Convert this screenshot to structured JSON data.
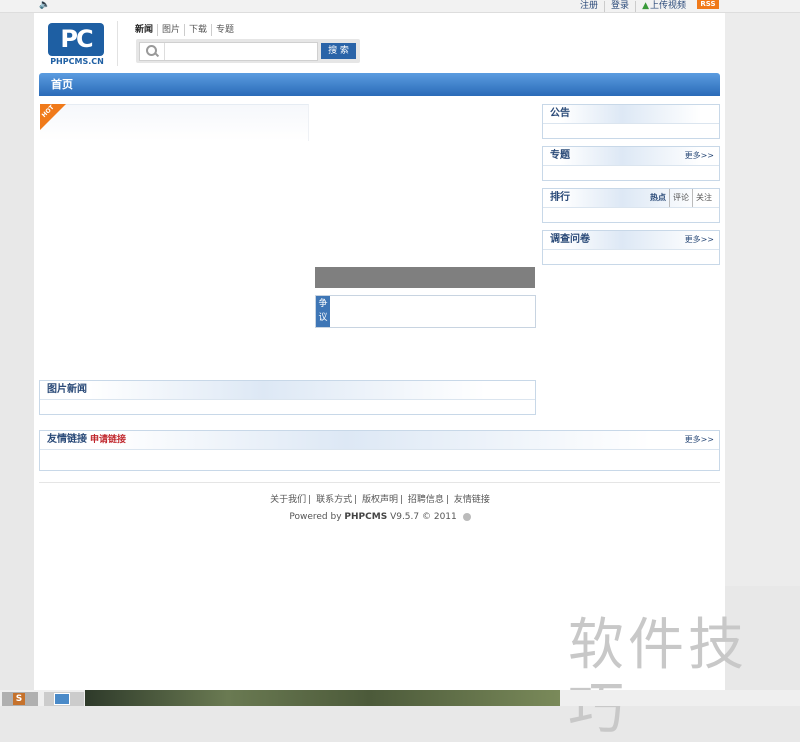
{
  "topbar": {
    "links": [
      "注册",
      "登录",
      "上传视频"
    ],
    "rss": "RSS"
  },
  "logo": {
    "mark": "PC",
    "sub": "PHPCMS.CN"
  },
  "nav": {
    "tabs": [
      "新闻",
      "图片",
      "下载",
      "专题"
    ]
  },
  "search": {
    "button": "搜 索",
    "placeholder": ""
  },
  "mainbar": {
    "title": "首页"
  },
  "hot_badge": "HOT",
  "zhengyi": {
    "label": "争议"
  },
  "panels": {
    "notice": {
      "title": "公告"
    },
    "special": {
      "title": "专题",
      "more": "更多>>"
    },
    "rank": {
      "title": "排行",
      "tabs": [
        "热点",
        "评论",
        "关注"
      ]
    },
    "survey": {
      "title": "调查问卷",
      "more": "更多>>"
    },
    "picnews": {
      "title": "图片新闻"
    },
    "friendlinks": {
      "title": "友情链接",
      "apply": "申请链接",
      "more": "更多>>"
    }
  },
  "footer": {
    "links": [
      "关于我们",
      "联系方式",
      "版权声明",
      "招聘信息",
      "友情链接"
    ],
    "powered_prefix": "Powered by",
    "powered_brand": "PHPCMS",
    "powered_version": "V9.5.7 © 2011"
  },
  "watermark": "软件技巧",
  "taskbar": {
    "app1": "S"
  }
}
